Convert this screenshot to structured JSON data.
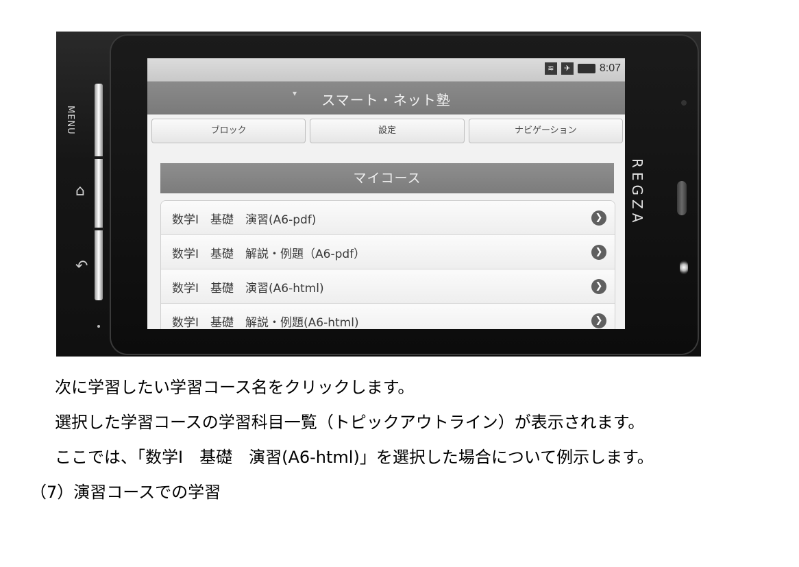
{
  "phone": {
    "side_label": "MENU",
    "brand": "REGZA",
    "status_bar": {
      "time": "8:07",
      "icons": [
        "wifi-icon",
        "airplane-icon",
        "battery-icon"
      ]
    },
    "app_title": "スマート・ネット塾",
    "nav_buttons": [
      {
        "label": "ブロック"
      },
      {
        "label": "設定"
      },
      {
        "label": "ナビゲーション"
      }
    ],
    "section_title": "マイコース",
    "courses": [
      {
        "label": "数学Ⅰ　基礎　演習(A6-pdf)"
      },
      {
        "label": "数学Ⅰ　基礎　解説・例題（A6-pdf）"
      },
      {
        "label": "数学Ⅰ　基礎　演習(A6-html)"
      },
      {
        "label": "数学Ⅰ　基礎　解説・例題(A6-html)"
      }
    ]
  },
  "document": {
    "lines": [
      "次に学習したい学習コース名をクリックします。",
      "選択した学習コースの学習科目一覧（トピックアウトライン）が表示されます。",
      "ここでは、「数学I　基礎　演習(A6-html)」を選択した場合について例示します。"
    ],
    "section_heading": "（7）演習コースでの学習"
  }
}
